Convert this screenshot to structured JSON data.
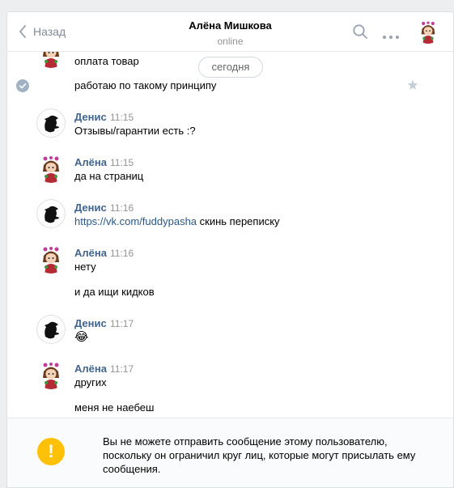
{
  "header": {
    "back_label": "Назад",
    "contact_name": "Алёна Мишкова",
    "contact_status": "online",
    "icons": [
      "chevron-left-icon",
      "search-icon",
      "more-icon"
    ]
  },
  "date_divider": "сегодня",
  "messages": [
    {
      "author": "",
      "time": "",
      "lines": [
        "оплата товар",
        "работаю по такому принципу"
      ]
    },
    {
      "author": "Денис",
      "time": "11:15",
      "lines": [
        "Отзывы/гарантии есть :?"
      ]
    },
    {
      "author": "Алёна",
      "time": "11:15",
      "lines": [
        "да на страниц"
      ]
    },
    {
      "author": "Денис",
      "time": "11:16",
      "link": "https://vk.com/fuddypasha",
      "after_link": "скинь переписку"
    },
    {
      "author": "Алёна",
      "time": "11:16",
      "lines": [
        "нету",
        "и да ищи кидков"
      ]
    },
    {
      "author": "Денис",
      "time": "11:17",
      "emoji": "😂"
    },
    {
      "author": "Алёна",
      "time": "11:17",
      "lines": [
        "других",
        "меня не наебеш"
      ]
    }
  ],
  "notice": {
    "icon": "warning-icon",
    "symbol": "!",
    "text": "Вы не можете отправить сообщение этому пользователю, поскольку он ограничил круг лиц, которые могут присылать ему сообщения."
  },
  "colors": {
    "author": "#42648b",
    "link": "#2a5885",
    "warning": "#ffc107",
    "page_bg": "#edeef0"
  }
}
